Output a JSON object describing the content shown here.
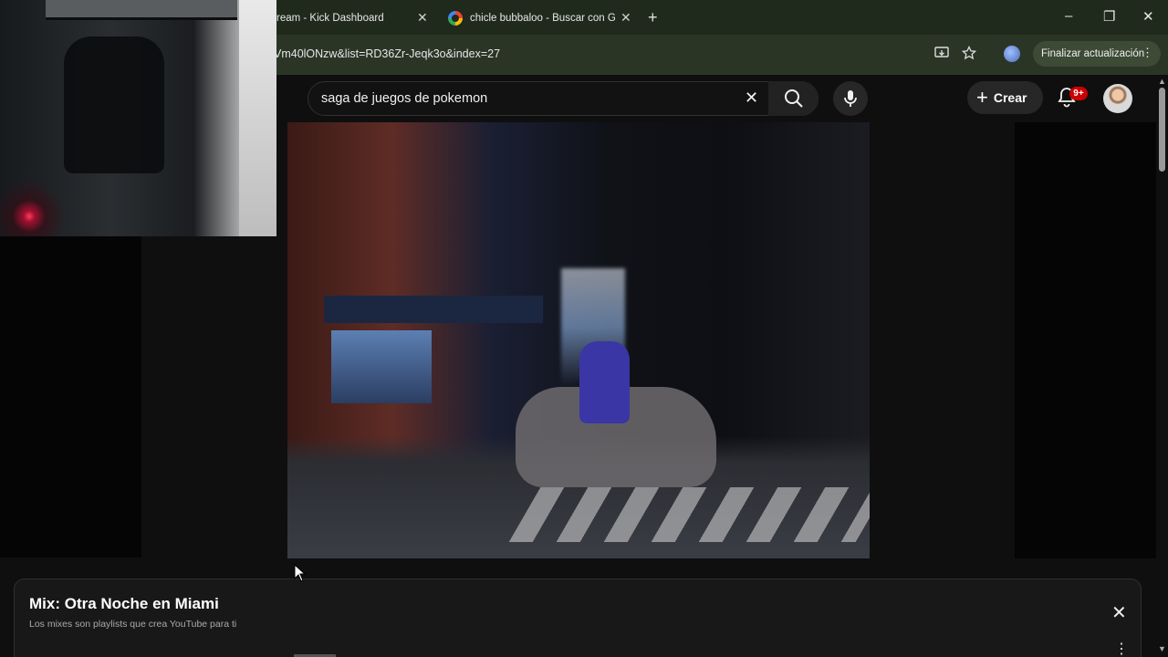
{
  "browser": {
    "tabs": [
      {
        "title": "ream - Kick Dashboard",
        "active": false
      },
      {
        "title": "chicle bubbaloo - Buscar con G",
        "active": false
      }
    ],
    "new_tab": "+",
    "window_controls": {
      "minimize": "–",
      "restore": "❐",
      "close": "✕"
    },
    "url": "Vm40lONzw&list=RD36Zr-Jeqk3o&index=27",
    "update_button": "Finalizar actualización",
    "icons": {
      "install": "install-icon",
      "bookmark": "star-icon",
      "profile": "profile-icon",
      "menu": "kebab-icon"
    }
  },
  "youtube": {
    "search": {
      "value": "saga de juegos de pokemon"
    },
    "create_label": "Crear",
    "notifications_badge": "9+"
  },
  "playlist_panel": {
    "title": "Mix: Otra Noche en Miami",
    "subtitle": "Los mixes son playlists que crea YouTube para ti"
  },
  "colors": {
    "background": "#0f0f0f",
    "badge": "#cc0000",
    "chrome": "#1f2a1c"
  }
}
